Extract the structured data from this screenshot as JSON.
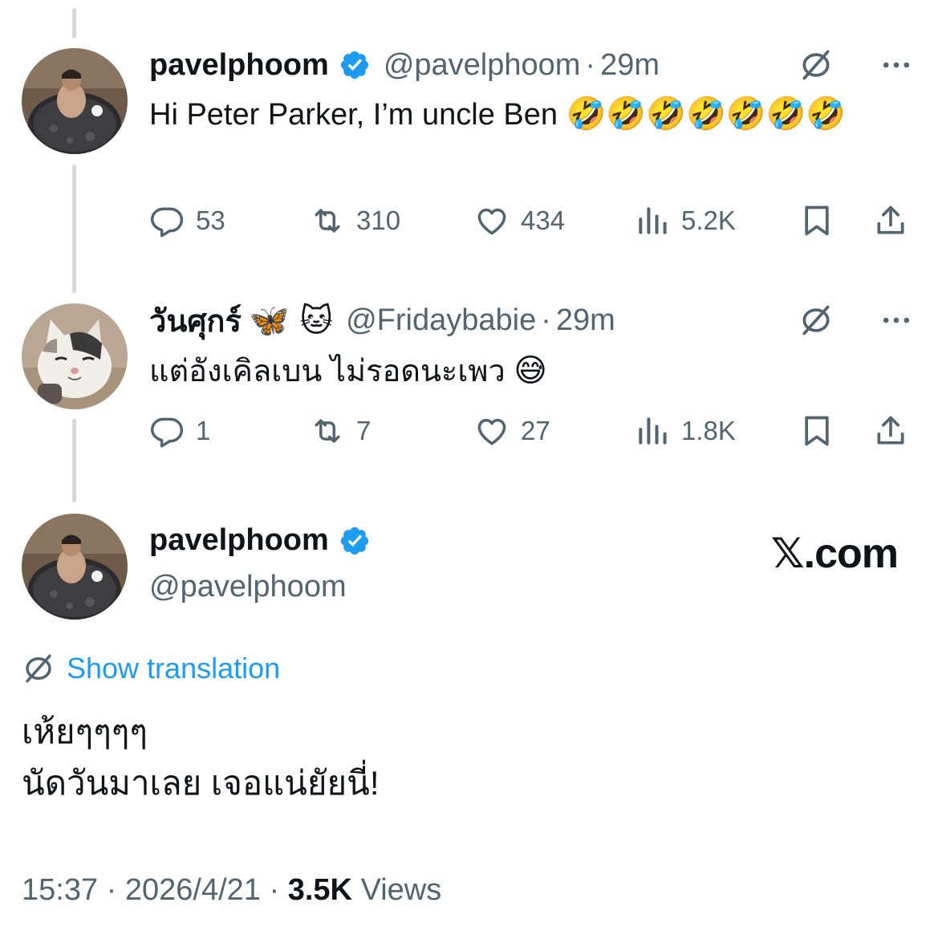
{
  "reply1": {
    "name": "pavelphoom",
    "handle": "@pavelphoom",
    "separator": "·",
    "time": "29m",
    "text": "Hi Peter Parker, I’m uncle Ben",
    "emojis": "🤣🤣🤣🤣🤣🤣🤣",
    "replies": "53",
    "retweets": "310",
    "likes": "434",
    "views": "5.2K"
  },
  "reply2": {
    "name": "วันศุกร์",
    "name_emojis": "🦋 🐱",
    "handle": "@Fridaybabie",
    "separator": "·",
    "time": "29m",
    "text": "แต่อังเคิลเบน ไม่รอดนะเพว",
    "emoji": "😅",
    "replies": "1",
    "retweets": "7",
    "likes": "27",
    "views": "1.8K"
  },
  "main": {
    "name": "pavelphoom",
    "handle": "@pavelphoom",
    "brand": "𝕏.com",
    "show_translation": "Show translation",
    "text_line1": "เห้ยๆๆๆๆ",
    "text_line2": "นัดวันมาเลย เจอแน่ยัยนี่!",
    "time": "15:37",
    "date": "2026/4/21",
    "views_count": "3.5K",
    "views_label": "Views",
    "separator": "·"
  },
  "colors": {
    "verified": "#1d9bf0",
    "link": "#1d9bf0",
    "secondary_text": "#536471",
    "thread_line": "#cfd9de"
  },
  "icons": [
    "verified-badge-icon",
    "translate-icon",
    "more-icon",
    "reply-icon",
    "retweet-icon",
    "like-icon",
    "views-icon",
    "bookmark-icon",
    "share-icon"
  ]
}
